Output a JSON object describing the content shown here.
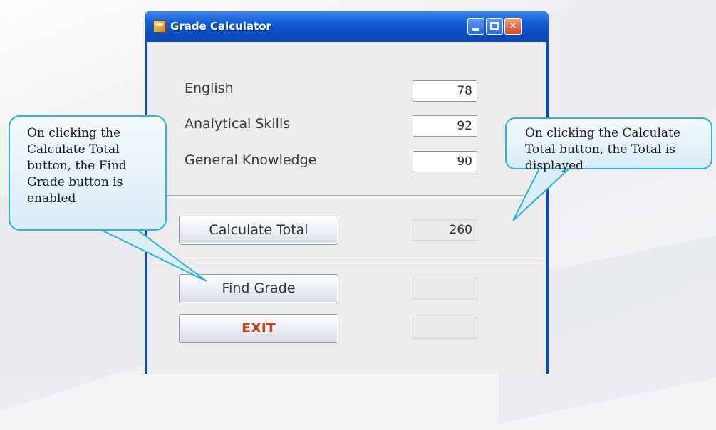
{
  "window": {
    "title": "Grade Calculator",
    "controls": {
      "minimize": "minimize-icon",
      "maximize": "maximize-icon",
      "close": "close-icon"
    }
  },
  "subjects": [
    {
      "label": "English",
      "value": "78"
    },
    {
      "label": "Analytical Skills",
      "value": "92"
    },
    {
      "label": "General Knowledge",
      "value": "90"
    }
  ],
  "buttons": {
    "calculate_total": "Calculate Total",
    "find_grade": "Find Grade",
    "exit": "EXIT"
  },
  "outputs": {
    "total": "260",
    "grade": "",
    "extra": ""
  },
  "callouts": {
    "left": [
      "On clicking the",
      "Calculate Total",
      "button, the Find",
      "Grade button is",
      "enabled"
    ],
    "right": [
      "On clicking the Calculate",
      "Total button, the Total is",
      "displayed"
    ]
  },
  "colors": {
    "titlebar": "#0a4cc0",
    "callout_border": "#29b3de",
    "exit_text": "#c8431a"
  }
}
